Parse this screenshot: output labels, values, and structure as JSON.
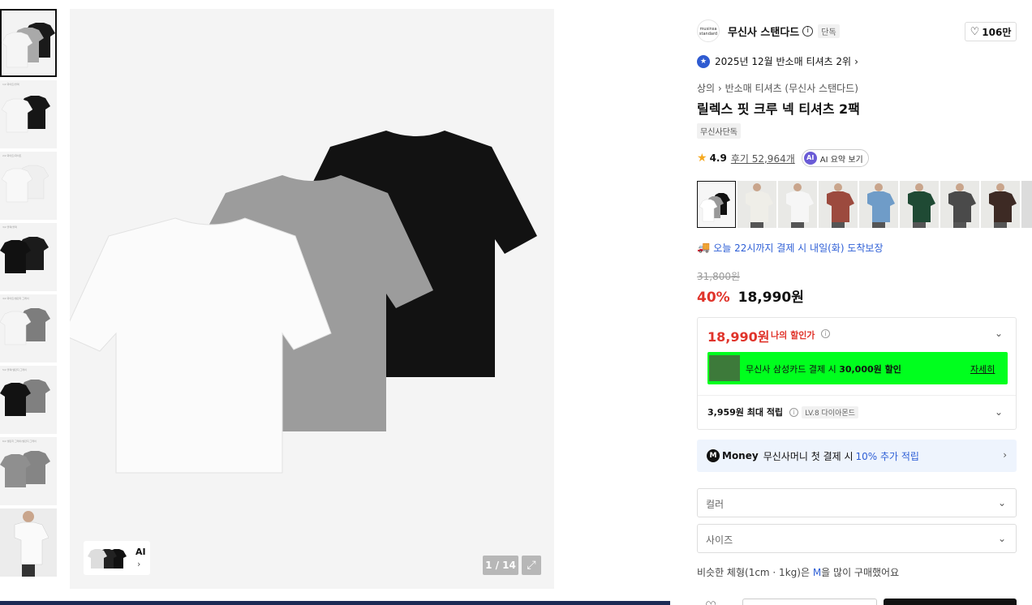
{
  "gallery": {
    "thumbnails": [
      {
        "id": "t1",
        "caption": ""
      },
      {
        "id": "t2",
        "caption": "1/2 화이트/블랙"
      },
      {
        "id": "t3",
        "caption": "2/2 화이트/화이트"
      },
      {
        "id": "t4",
        "caption": "3/2 블랙/블랙"
      },
      {
        "id": "t5",
        "caption": "4/2 화이트/멜란지 그레이"
      },
      {
        "id": "t6",
        "caption": "5/2 블랙/멜란지 그레이"
      },
      {
        "id": "t7",
        "caption": "6/2 멜란지 그레이/멜란지 그레이"
      },
      {
        "id": "t8",
        "caption": ""
      }
    ],
    "ai_label": "AI",
    "ai_chevron": "›",
    "counter": "1 / 14",
    "expand_icon": "⤢"
  },
  "brand": {
    "logo_text_1": "musinsa",
    "logo_text_2": "standard",
    "name": "무신사 스탠다드",
    "info_icon": "i",
    "exclusive": "단독",
    "likes": "106만"
  },
  "ranking": {
    "badge_icon": "★",
    "text": "2025년 12월 반소매 티셔츠 2위",
    "chevron": "›"
  },
  "breadcrumb": {
    "level1": "상의",
    "sep": "›",
    "level2": "반소매 티셔츠 (무신사 스탠다드)"
  },
  "product": {
    "title": "릴렉스 핏 크루 넥 티셔츠 2팩",
    "tag": "무신사단독",
    "rating": "4.9",
    "reviews": "후기 52,964개",
    "ai_summary_icon": "AI",
    "ai_summary": "AI 요약 보기"
  },
  "swatches": [
    {
      "color": "#2a2a2a",
      "active": true
    },
    {
      "color": "#efeee8"
    },
    {
      "color": "#f2f2f2"
    },
    {
      "color": "#9c4a3e"
    },
    {
      "color": "#6f9cc8"
    },
    {
      "color": "#1f4a34"
    },
    {
      "color": "#4a4a4a"
    },
    {
      "color": "#3d2a24"
    },
    {
      "color": "#dcdcdc"
    }
  ],
  "delivery": {
    "icon": "🚚",
    "text": "오늘 22시까지 결제 시 내일(화) 도착보장"
  },
  "price": {
    "original": "31,800원",
    "discount": "40%",
    "final": "18,990원"
  },
  "my_discount": {
    "price": "18,990원",
    "label": "나의 할인가",
    "info_icon": "i",
    "chevron": "⌄",
    "card_prefix": "무신사 삼성카드 결제 시 ",
    "card_amount": "30,000원 할인",
    "card_more": "자세히",
    "points": "3,959원 최대 적립",
    "points_info": "i",
    "level": "LV.8 다이아몬드"
  },
  "money": {
    "icon": "M",
    "brand": "Money",
    "text": "무신사머니 첫 결제 시",
    "highlight": "10% 추가 적립",
    "chevron": "›"
  },
  "options": {
    "color_placeholder": "컬러",
    "size_placeholder": "사이즈",
    "chevron": "⌄"
  },
  "hint": {
    "prefix": "비슷한 체형(1cm · 1kg)은 ",
    "size": "M",
    "suffix": "을 많이 구매했어요"
  },
  "bottom": {
    "heart_icon": "♡"
  }
}
